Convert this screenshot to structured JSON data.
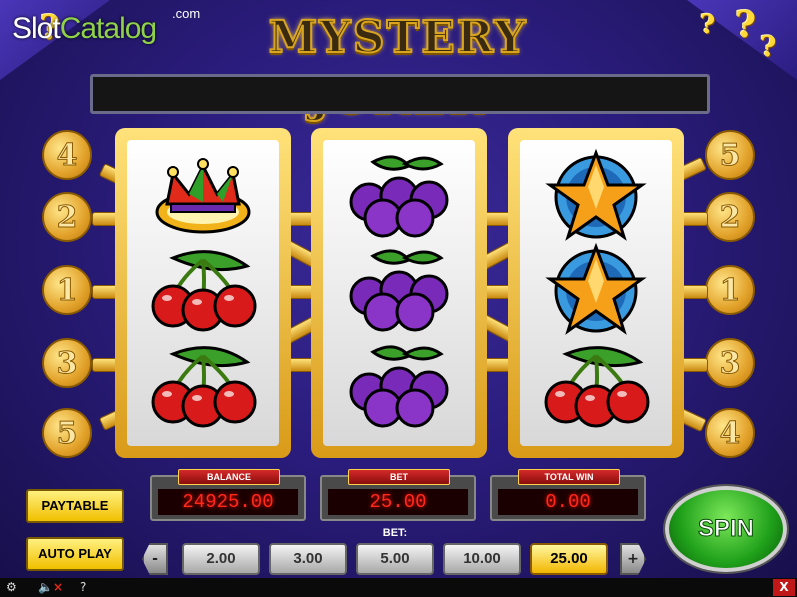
{
  "branding": {
    "watermark_slot": "Slot",
    "watermark_catalog": "Catalog",
    "watermark_suffix": ".com",
    "game_title": "MYSTERY JOKER"
  },
  "message_bar": "",
  "reels": [
    {
      "symbols": [
        "jester-crown",
        "cherries",
        "cherries"
      ]
    },
    {
      "symbols": [
        "plums",
        "plums",
        "plums"
      ]
    },
    {
      "symbols": [
        "star",
        "star",
        "cherries"
      ]
    }
  ],
  "paylines": {
    "left": [
      "4",
      "2",
      "1",
      "3",
      "5"
    ],
    "right": [
      "5",
      "2",
      "1",
      "3",
      "4"
    ]
  },
  "meters": {
    "balance_label": "BALANCE",
    "balance_value": "24925.00",
    "bet_label": "BET",
    "bet_value": "25.00",
    "win_label": "TOTAL WIN",
    "win_value": "0.00"
  },
  "buttons": {
    "paytable": "PAYTABLE",
    "autoplay": "AUTO PLAY",
    "spin": "SPIN",
    "minus": "-",
    "plus": "+",
    "close": "X"
  },
  "bet_selector": {
    "label": "BET:",
    "options": [
      "2.00",
      "3.00",
      "5.00",
      "10.00",
      "25.00"
    ],
    "selected": "25.00"
  },
  "bottom_bar": {
    "help": "?"
  },
  "colors": {
    "meter_digits": "#ff2a1a",
    "spin_green": "#1fa01a",
    "gold": "#e2a22a",
    "background": "#2a1c7c"
  }
}
